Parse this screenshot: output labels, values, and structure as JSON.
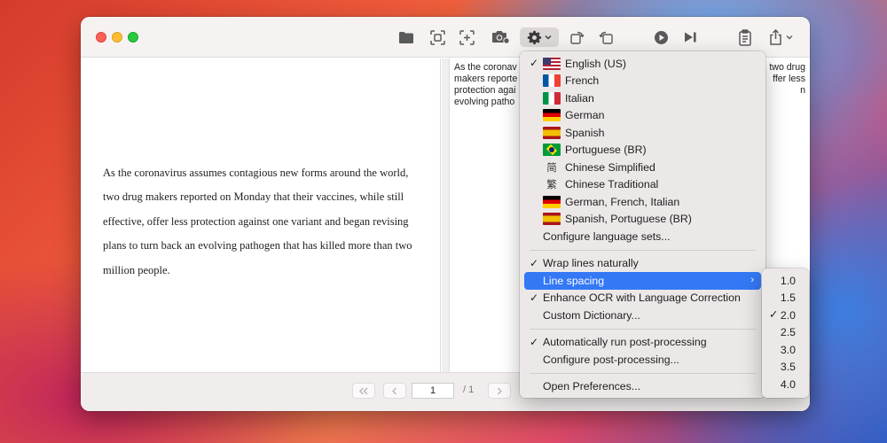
{
  "document": {
    "text": "As the coronavirus assumes contagious new forms around the world, two drug makers reported on Monday that their vaccines, while still effective, offer less protection against one variant and began revising plans to turn back an evolving pathogen that has killed more than two million people."
  },
  "ocr": {
    "line1_left": "As the coronav",
    "line1_right": "two drug",
    "line2_left": "makers reporte",
    "line2_right": "ffer less",
    "line3_left": "protection agai",
    "line3_right": "n",
    "line4_left": "evolving patho"
  },
  "toolbar": {
    "icons": [
      "folder-icon",
      "capture-area-icon",
      "capture-selection-icon",
      "camera-icon",
      "gear-icon",
      "rotate-left-icon",
      "rotate-right-icon",
      "play-icon",
      "skip-forward-icon",
      "clipboard-icon",
      "share-icon"
    ]
  },
  "pager": {
    "page": "1",
    "total": "/ 1"
  },
  "menu": {
    "languages": [
      {
        "label": "English (US)",
        "flag": "us",
        "checked": true
      },
      {
        "label": "French",
        "flag": "fr",
        "checked": false
      },
      {
        "label": "Italian",
        "flag": "it",
        "checked": false
      },
      {
        "label": "German",
        "flag": "de",
        "checked": false
      },
      {
        "label": "Spanish",
        "flag": "es",
        "checked": false
      },
      {
        "label": "Portuguese (BR)",
        "flag": "br",
        "checked": false
      },
      {
        "label": "Chinese Simplified",
        "glyph": "简",
        "checked": false
      },
      {
        "label": "Chinese Traditional",
        "glyph": "繁",
        "checked": false
      },
      {
        "label": "German, French, Italian",
        "flag": "de",
        "checked": false
      },
      {
        "label": "Spanish, Portuguese (BR)",
        "flag": "es",
        "checked": false
      }
    ],
    "configure_languages": "Configure language sets...",
    "wrap_lines": "Wrap lines naturally",
    "line_spacing": "Line spacing",
    "enhance_ocr": "Enhance OCR with Language Correction",
    "custom_dictionary": "Custom Dictionary...",
    "auto_post": "Automatically run post-processing",
    "configure_post": "Configure post-processing...",
    "open_prefs": "Open Preferences...",
    "check_glyph": "✓",
    "submenu_arrow": "›"
  },
  "line_spacing_options": [
    {
      "label": "1.0",
      "checked": false
    },
    {
      "label": "1.5",
      "checked": false
    },
    {
      "label": "2.0",
      "checked": true
    },
    {
      "label": "2.5",
      "checked": false
    },
    {
      "label": "3.0",
      "checked": false
    },
    {
      "label": "3.5",
      "checked": false
    },
    {
      "label": "4.0",
      "checked": false
    }
  ],
  "colors": {
    "selection": "#3478f6",
    "close": "#fe5f57",
    "minimize": "#febc2e",
    "maximize": "#28c840"
  }
}
